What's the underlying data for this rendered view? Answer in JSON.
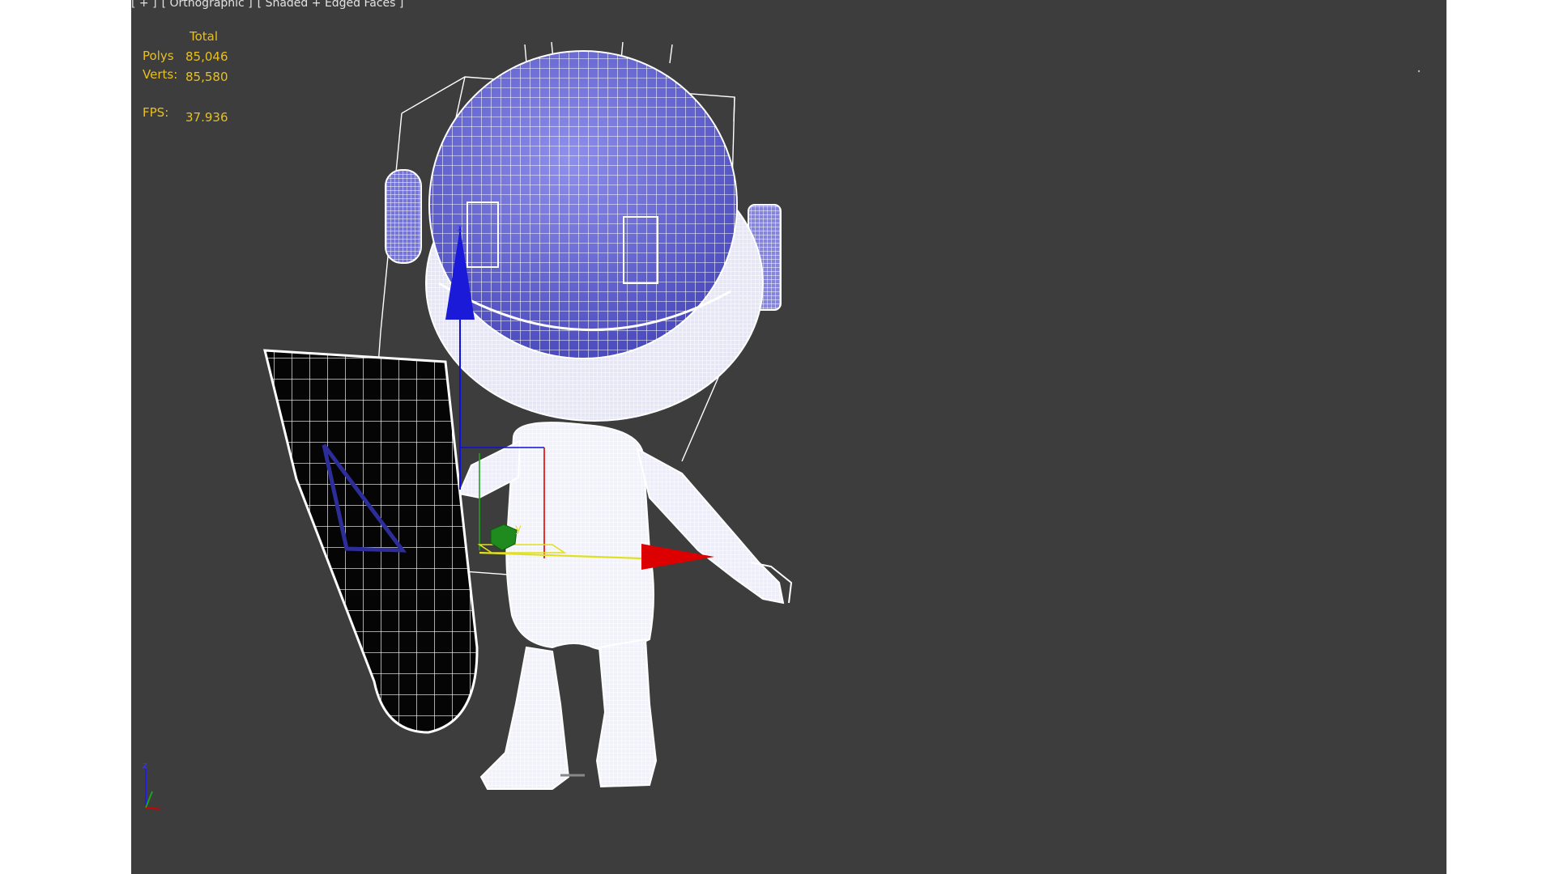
{
  "viewport": {
    "label_plus": "[ + ]",
    "label_view": "[ Orthographic ]",
    "label_shading": "[ Shaded + Edged Faces ]"
  },
  "stats": {
    "header": "Total",
    "polys_label": "Polys",
    "polys_value": "85,046",
    "verts_label": "Verts:",
    "verts_value": "85,580",
    "fps_label": "FPS:",
    "fps_value": "37.936"
  },
  "gizmo": {
    "z_label": "z",
    "y_label": "y"
  },
  "colors": {
    "viewport_bg": "#3d3d3d",
    "stats_text": "#e8c020",
    "helmet": "#6e6ed8",
    "wire": "#ffffff",
    "axis_x": "#e00000",
    "axis_y": "#20a020",
    "axis_z": "#1010d8",
    "shield": "#000000"
  }
}
